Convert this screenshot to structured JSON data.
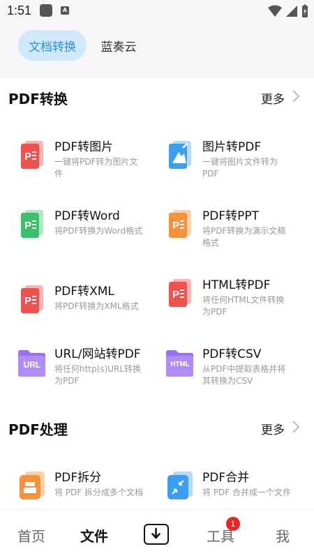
{
  "status_bar": {
    "time": "1:51",
    "app_badge": "A"
  },
  "top_tabs": {
    "active": "文档转换",
    "inactive": "蓝奏云"
  },
  "sections": [
    {
      "title": "PDF转换",
      "more": "更多",
      "items": [
        {
          "title": "PDF转图片",
          "desc": "一键将PDF转为图片文件",
          "icon": "pdf-red-icon"
        },
        {
          "title": "图片转PDF",
          "desc": "一键将图片文件转为PDF",
          "icon": "image-blue-icon"
        },
        {
          "title": "PDF转Word",
          "desc": "将PDF转换为Word格式",
          "icon": "pdf-green-icon"
        },
        {
          "title": "PDF转PPT",
          "desc": "将PDF转换为演示文稿格式",
          "icon": "pdf-orange-icon"
        },
        {
          "title": "PDF转XML",
          "desc": "将PDF转换为XML格式",
          "icon": "pdf-red-icon"
        },
        {
          "title": "HTML转PDF",
          "desc": "将任何HTML文件转换为PDF",
          "icon": "pdf-red-icon"
        },
        {
          "title": "URL/网站转PDF",
          "desc": "将任何http(s)URL转换为PDF",
          "icon": "url-folder-icon",
          "icon_label": "URL"
        },
        {
          "title": "PDF转CSV",
          "desc": "从PDF中提取表格并将其转换为CSV",
          "icon": "html-folder-icon",
          "icon_label": "HTML"
        }
      ]
    },
    {
      "title": "PDF处理",
      "more": "更多",
      "items": [
        {
          "title": "PDF拆分",
          "desc": "将 PDF 拆分成多个文档",
          "icon": "split-orange-icon"
        },
        {
          "title": "PDF合并",
          "desc": "将 PDF 合并成一个文件",
          "icon": "merge-blue-icon"
        }
      ]
    }
  ],
  "bottom_nav": {
    "home": "首页",
    "files": "文件",
    "tools": "工具",
    "tools_badge": "1",
    "me": "我"
  },
  "colors": {
    "accent": "#2a90e0",
    "pdf_red": "#f0524f",
    "word_green": "#3bc06a",
    "ppt_orange": "#f7913a",
    "image_blue": "#3b9ef0",
    "folder_purple": "#9a72f0"
  }
}
